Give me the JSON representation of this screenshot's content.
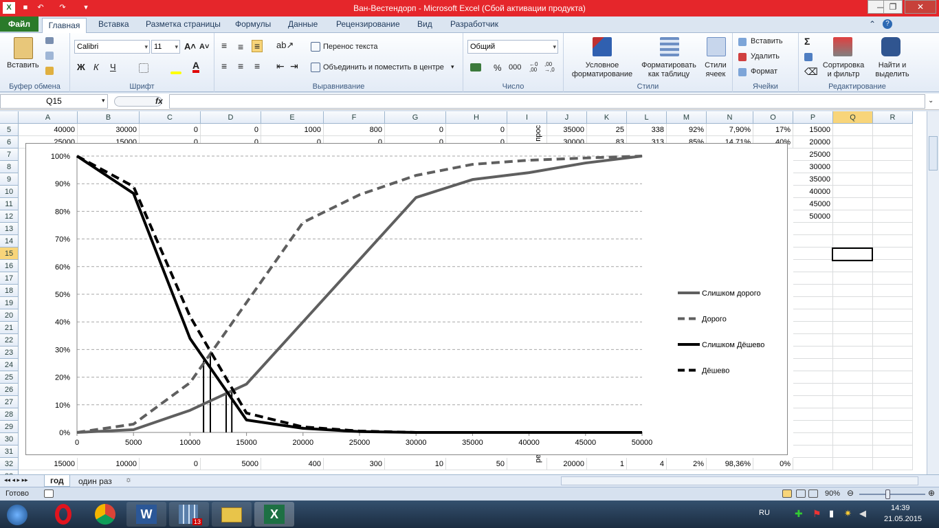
{
  "window": {
    "title": "Ван-Вестендорп  -  Microsoft Excel (Сбой активации продукта)"
  },
  "tabs": [
    "Файл",
    "Главная",
    "Вставка",
    "Разметка страницы",
    "Формулы",
    "Данные",
    "Рецензирование",
    "Вид",
    "Разработчик"
  ],
  "ribbon": {
    "clipboard": {
      "paste": "Вставить",
      "label": "Буфер обмена"
    },
    "font": {
      "name": "Calibri",
      "size": "11",
      "label": "Шрифт"
    },
    "align": {
      "wrap": "Перенос текста",
      "merge": "Объединить и поместить в центре",
      "label": "Выравнивание"
    },
    "number": {
      "format": "Общий",
      "label": "Число"
    },
    "styles": {
      "cond": "Условное форматирование",
      "table": "Форматировать как таблицу",
      "cell": "Стили ячеек",
      "label": "Стили"
    },
    "cells": {
      "insert": "Вставить",
      "delete": "Удалить",
      "format": "Формат",
      "label": "Ячейки"
    },
    "editing": {
      "sort": "Сортировка и фильтр",
      "find": "Найти и выделить",
      "label": "Редактирование"
    }
  },
  "formula_bar": {
    "name_box": "Q15",
    "fx": "fx"
  },
  "columns": [
    "A",
    "B",
    "C",
    "D",
    "E",
    "F",
    "G",
    "H",
    "I",
    "J",
    "K",
    "L",
    "M",
    "N",
    "O",
    "P",
    "Q",
    "R"
  ],
  "rows_top": [
    {
      "num": "5",
      "cells": [
        "40000",
        "30000",
        "0",
        "0",
        "1000",
        "800",
        "0",
        "0",
        "",
        "35000",
        "25",
        "338",
        "92%",
        "7,90%",
        "17%",
        "15000"
      ]
    },
    {
      "num": "6",
      "cells": [
        "25000",
        "15000",
        "0",
        "0",
        "0",
        "0",
        "0",
        "0",
        "",
        "30000",
        "83",
        "313",
        "85%",
        "14,71%",
        "40%",
        "20000"
      ]
    }
  ],
  "i_col_text": [
    "прос",
    "рети"
  ],
  "p_values": [
    "25000",
    "30000",
    "35000",
    "40000",
    "45000",
    "50000"
  ],
  "row_numbers": [
    "7",
    "8",
    "9",
    "10",
    "11",
    "12",
    "13",
    "14",
    "15",
    "16",
    "17",
    "18",
    "19",
    "20",
    "21",
    "22",
    "23",
    "24",
    "25",
    "26",
    "27",
    "28",
    "29",
    "30",
    "31"
  ],
  "row32": {
    "num": "32",
    "cells": [
      "15000",
      "10000",
      "0",
      "5000",
      "400",
      "300",
      "10",
      "50",
      "",
      "20000",
      "1",
      "4",
      "2%",
      "98,36%",
      "0%"
    ]
  },
  "row33": {
    "num": "33"
  },
  "sheet_tabs": [
    "год",
    "один раз"
  ],
  "status": {
    "ready": "Готово",
    "zoom": "90%"
  },
  "taskbar": {
    "lang": "RU",
    "time": "14:39",
    "date": "21.05.2015",
    "word_badge": "13"
  },
  "chart_data": {
    "type": "line",
    "x_ticks": [
      0,
      5000,
      10000,
      15000,
      20000,
      25000,
      30000,
      35000,
      40000,
      45000,
      50000
    ],
    "ylim": [
      0,
      1
    ],
    "y_ticks": [
      "0%",
      "10%",
      "20%",
      "30%",
      "40%",
      "50%",
      "60%",
      "70%",
      "80%",
      "90%",
      "100%"
    ],
    "grid": true,
    "legend": "right",
    "series": [
      {
        "name": "Слишком дорого",
        "style": "solid",
        "color": "#5f5f5f",
        "x": [
          0,
          5000,
          10000,
          15000,
          20000,
          25000,
          30000,
          35000,
          40000,
          45000,
          50000
        ],
        "y": [
          0,
          0.01,
          0.08,
          0.175,
          0.4,
          0.625,
          0.85,
          0.915,
          0.94,
          0.975,
          1.0
        ]
      },
      {
        "name": "Дорого",
        "style": "dashed",
        "color": "#5f5f5f",
        "x": [
          0,
          5000,
          10000,
          15000,
          20000,
          25000,
          30000,
          35000,
          40000,
          45000,
          50000
        ],
        "y": [
          0,
          0.03,
          0.18,
          0.47,
          0.76,
          0.86,
          0.93,
          0.97,
          0.985,
          0.993,
          1.0
        ]
      },
      {
        "name": "Слишком Дёшево",
        "style": "solid",
        "color": "#000000",
        "x": [
          0,
          5000,
          10000,
          15000,
          20000,
          25000,
          30000,
          35000,
          40000,
          45000,
          50000
        ],
        "y": [
          1.0,
          0.865,
          0.34,
          0.045,
          0.015,
          0.003,
          0,
          0,
          0,
          0,
          0
        ]
      },
      {
        "name": "Дёшево",
        "style": "dashed",
        "color": "#000000",
        "x": [
          0,
          5000,
          10000,
          15000,
          20000,
          25000,
          30000,
          35000,
          40000,
          45000,
          50000
        ],
        "y": [
          1.0,
          0.89,
          0.42,
          0.07,
          0.02,
          0.005,
          0,
          0,
          0,
          0,
          0
        ]
      }
    ],
    "markers": [
      {
        "x": 11200,
        "y": 0.26
      },
      {
        "x": 11800,
        "y": 0.29
      },
      {
        "x": 13200,
        "y": 0.15
      },
      {
        "x": 13700,
        "y": 0.16
      }
    ]
  }
}
